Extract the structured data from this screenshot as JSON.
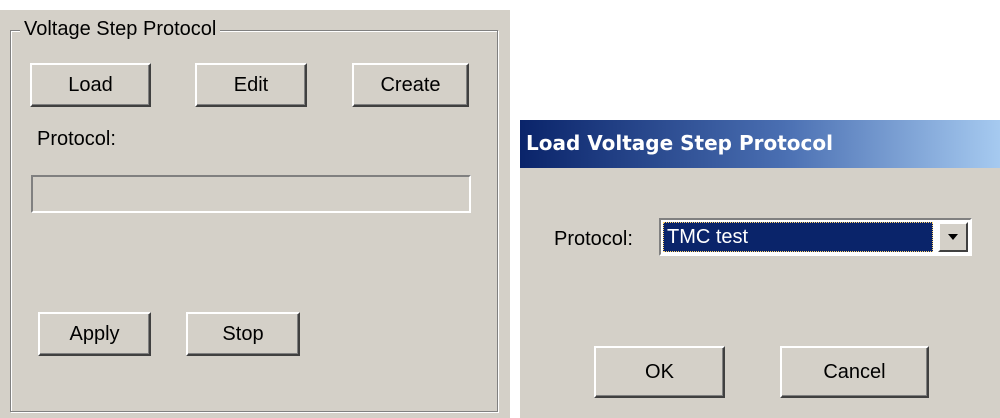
{
  "panel": {
    "group_title": "Voltage Step Protocol",
    "load_label": "Load",
    "edit_label": "Edit",
    "create_label": "Create",
    "protocol_label": "Protocol:",
    "protocol_value": "",
    "apply_label": "Apply",
    "stop_label": "Stop"
  },
  "dialog": {
    "title": "Load Voltage Step Protocol",
    "protocol_label": "Protocol:",
    "protocol_selected": "TMC test",
    "ok_label": "OK",
    "cancel_label": "Cancel",
    "titlebar_colors": [
      "#0a246a",
      "#a6caf0"
    ]
  },
  "icons": {
    "combo_arrow": "chevron-down-icon"
  },
  "colors": {
    "window_face": "#d4d0c8",
    "selection": "#0a246a"
  }
}
